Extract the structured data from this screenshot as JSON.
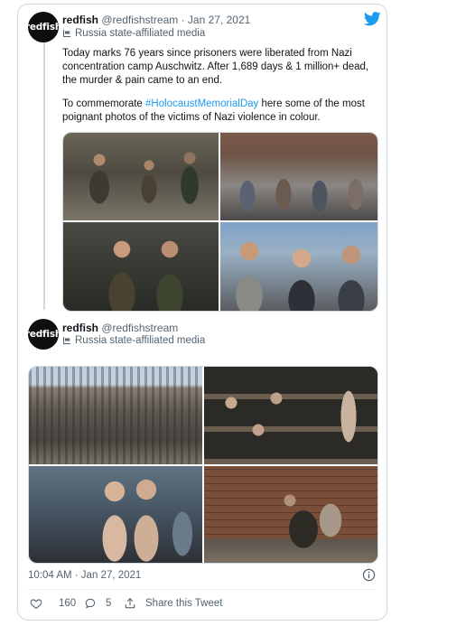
{
  "tweet1": {
    "avatar_text": "redfish",
    "name": "redfish",
    "handle": "@redfishstream",
    "separator": "·",
    "date": "Jan 27, 2021",
    "label": "Russia state-affiliated media",
    "para1": "Today marks 76 years since prisoners were liberated from Nazi concentration camp Auschwitz. After 1,689 days & 1 million+ dead, the murder & pain came to an end.",
    "para2_before": "To commemorate ",
    "hashtag": "#HolocaustMemorialDay",
    "para2_after": " here some of the most poignant photos of the victims of Nazi violence in colour."
  },
  "tweet2": {
    "avatar_text": "redfish",
    "name": "redfish",
    "handle": "@redfishstream",
    "label": "Russia state-affiliated media"
  },
  "footer": {
    "timestamp": "10:04 AM · Jan 27, 2021",
    "likes": "160",
    "replies": "5",
    "share": "Share this Tweet"
  },
  "icons": [
    "twitter-bird-icon",
    "state-media-flag-icon",
    "info-icon",
    "heart-icon",
    "reply-icon",
    "share-icon"
  ],
  "colors": {
    "accent": "#1d9bf0",
    "muted": "#536471",
    "border": "#cfd9de"
  }
}
